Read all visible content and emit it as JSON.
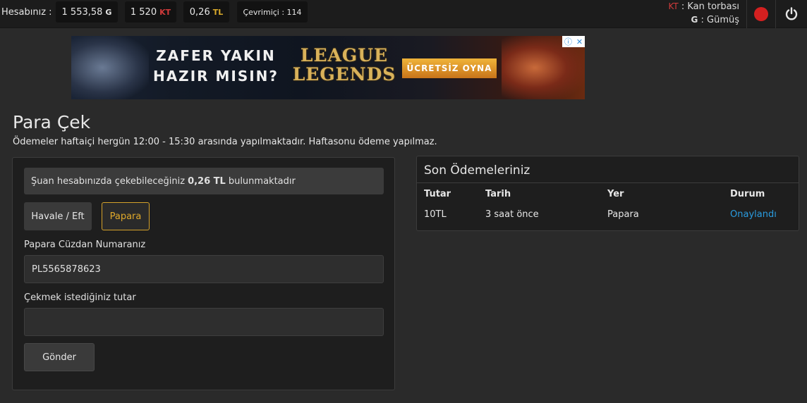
{
  "topbar": {
    "account_label": "Hesabınız :",
    "balances": [
      {
        "value": "1 553,58",
        "unit": "G"
      },
      {
        "value": "1 520",
        "unit": "KT"
      },
      {
        "value": "0,26",
        "unit": "TL"
      }
    ],
    "online": "Çevrimiçi : 114",
    "legend": {
      "kt_key": "KT",
      "kt_text": " : Kan torbası",
      "g_key": "G",
      "g_text": " : Gümüş"
    },
    "icons": {
      "record": "record-icon",
      "power": "power-icon"
    }
  },
  "banner": {
    "slogan_line1": "ZAFER YAKIN",
    "slogan_line2": "HAZIR MISIN?",
    "brand_line1": "LEAGUE",
    "brand_line2": "LEGENDS",
    "cta": "ÜCRETSİZ OYNA"
  },
  "page": {
    "title": "Para Çek",
    "subtitle": "Ödemeler haftaiçi hergün 12:00 - 15:30 arasında yapılmaktadır. Haftasonu ödeme yapılmaz."
  },
  "withdraw": {
    "info_prefix": "Şuan hesabınızda çekebileceğiniz",
    "info_amount": "0,26 TL",
    "info_suffix": "bulunmaktadır",
    "methods": [
      "Havale / Eft",
      "Papara"
    ],
    "selected_method": "Papara",
    "wallet_label": "Papara Cüzdan Numaranız",
    "wallet_value": "PL5565878623",
    "amount_label": "Çekmek istediğiniz tutar",
    "amount_value": "",
    "submit_label": "Gönder"
  },
  "recent": {
    "title": "Son Ödemeleriniz",
    "columns": [
      "Tutar",
      "Tarih",
      "Yer",
      "Durum"
    ],
    "rows": [
      [
        "10TL",
        "3 saat önce",
        "Papara",
        "Onaylandı"
      ]
    ]
  },
  "colors": {
    "kt_red": "#d03a3a",
    "tl_gold": "#d9a92a",
    "papara_accent": "#d4a22a",
    "status_blue": "#2a9ce0",
    "record_red": "#d42020"
  }
}
